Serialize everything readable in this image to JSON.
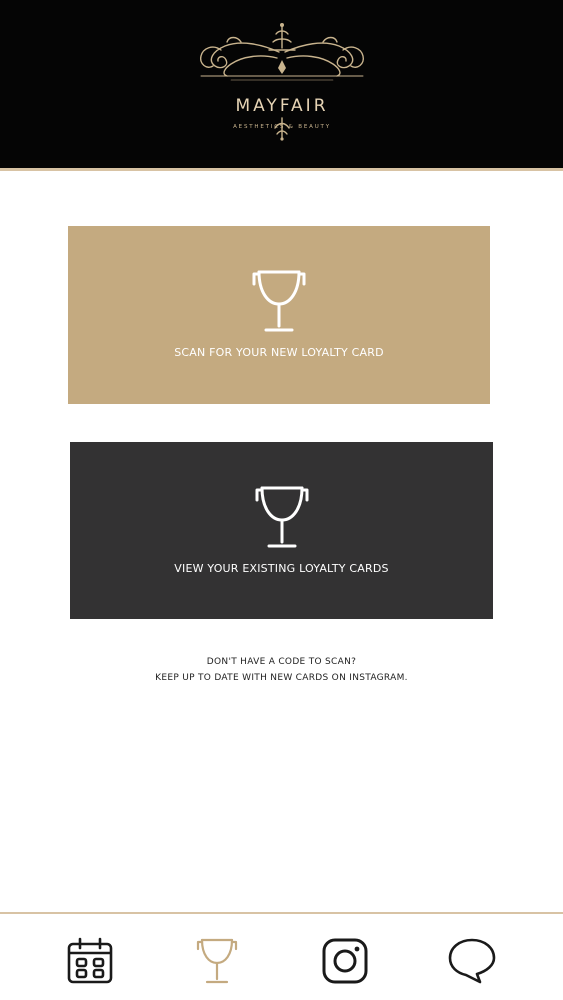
{
  "header": {
    "brand_name": "MAYFAIR",
    "brand_tagline": "AESTHETICS & BEAUTY"
  },
  "cards": {
    "scan": {
      "label": "SCAN FOR YOUR NEW LOYALTY CARD",
      "icon": "trophy-icon",
      "background": "#c4aa80"
    },
    "view": {
      "label": "VIEW YOUR EXISTING LOYALTY CARDS",
      "icon": "trophy-icon",
      "background": "#333233"
    }
  },
  "info": {
    "line1": "DON'T HAVE A CODE TO SCAN?",
    "line2": "KEEP UP TO DATE WITH NEW CARDS ON INSTAGRAM."
  },
  "bottom_nav": {
    "items": [
      {
        "icon": "calendar-icon",
        "active": false
      },
      {
        "icon": "trophy-icon",
        "active": true
      },
      {
        "icon": "instagram-icon",
        "active": false
      },
      {
        "icon": "chat-icon",
        "active": false
      }
    ]
  },
  "colors": {
    "header_bg": "#050505",
    "gold": "#c4aa80",
    "dark_card": "#333233",
    "accent_line": "#d8c3a4"
  }
}
